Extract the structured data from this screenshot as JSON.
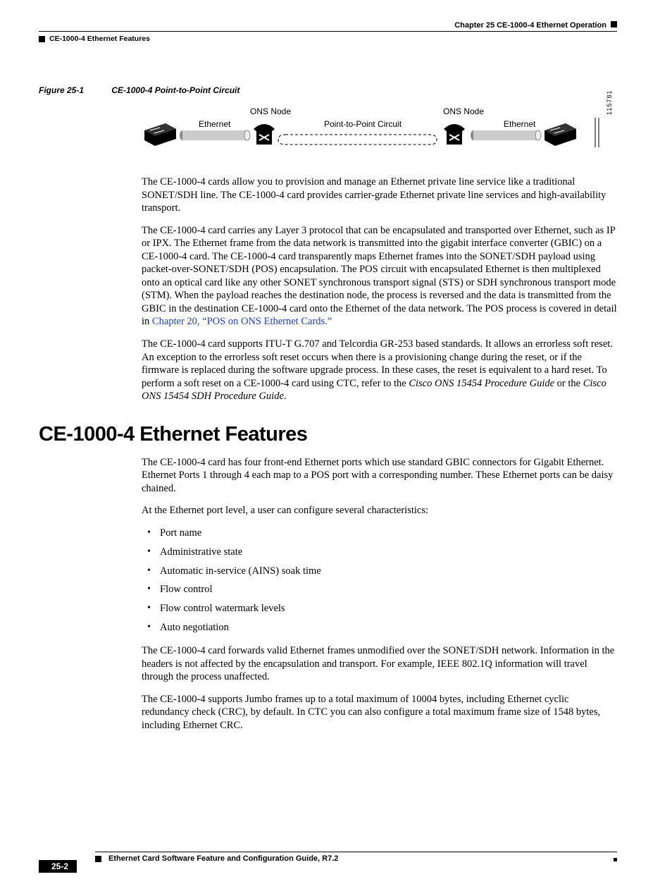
{
  "header": {
    "chapter": "Chapter 25   CE-1000-4 Ethernet Operation",
    "section": "CE-1000-4 Ethernet Features"
  },
  "figure": {
    "number": "Figure 25-1",
    "title": "CE-1000-4 Point-to-Point Circuit",
    "label_ons_left": "ONS Node",
    "label_ons_right": "ONS Node",
    "label_eth_left": "Ethernet",
    "label_eth_right": "Ethernet",
    "label_ptp": "Point-to-Point Circuit",
    "sidecode": "115781"
  },
  "para1": "The CE-1000-4 cards allow you to provision and manage an Ethernet private line service like a traditional SONET/SDH line. The CE-1000-4 card provides carrier-grade Ethernet private line services and high-availability transport.",
  "para2a": "The CE-1000-4 card carries any Layer 3 protocol that can be encapsulated and transported over Ethernet, such as IP or IPX. The Ethernet frame from the data network is transmitted into the gigabit interface converter (GBIC) on a CE-1000-4 card. The CE-1000-4 card transparently maps Ethernet frames into the SONET/SDH payload using packet-over-SONET/SDH (POS) encapsulation. The POS circuit with encapsulated Ethernet is then multiplexed onto an optical card like any other SONET synchronous transport signal (STS) or SDH synchronous transport mode (STM). When the payload reaches the destination node, the process is reversed and the data is transmitted from the GBIC in the destination CE-1000-4 card onto the Ethernet of the data network. The POS process is covered in detail in ",
  "para2link": "Chapter 20, “POS on ONS Ethernet Cards.”",
  "para3a": "The CE-1000-4 card supports ITU-T G.707 and Telcordia GR-253 based standards. It allows an errorless soft reset. An exception to the errorless soft reset occurs when there is a provisioning change during the reset, or if the firmware is replaced during the software upgrade process. In these cases, the reset is equivalent to a hard reset. To perform a soft reset on a CE-1000-4 card using CTC, refer to the ",
  "para3em1": "Cisco ONS 15454 Procedure Guide",
  "para3mid": " or the ",
  "para3em2": "Cisco ONS 15454 SDH Procedure Guide",
  "para3end": ".",
  "heading": "CE-1000-4 Ethernet Features",
  "para4": "The CE-1000-4 card has four front-end Ethernet ports which use standard GBIC connectors for Gigabit Ethernet. Ethernet Ports 1 through 4 each map to a POS port with a corresponding number. These Ethernet ports can be daisy chained.",
  "para5": "At the Ethernet port level, a user can configure several characteristics:",
  "bullets": [
    "Port name",
    "Administrative state",
    "Automatic in-service (AINS) soak time",
    "Flow control",
    "Flow control watermark levels",
    "Auto negotiation"
  ],
  "para6": "The CE-1000-4 card forwards valid Ethernet frames unmodified over the SONET/SDH network. Information in the headers is not affected by the encapsulation and transport. For example, IEEE 802.1Q information will travel through the process unaffected.",
  "para7": "The CE-1000-4 supports Jumbo frames up to a total maximum of 10004 bytes, including Ethernet cyclic redundancy check (CRC), by default. In CTC you can also configure a total maximum frame size of 1548 bytes, including Ethernet CRC.",
  "footer": {
    "guide": "Ethernet Card Software Feature and Configuration Guide, R7.2",
    "pagenum": "25-2"
  }
}
